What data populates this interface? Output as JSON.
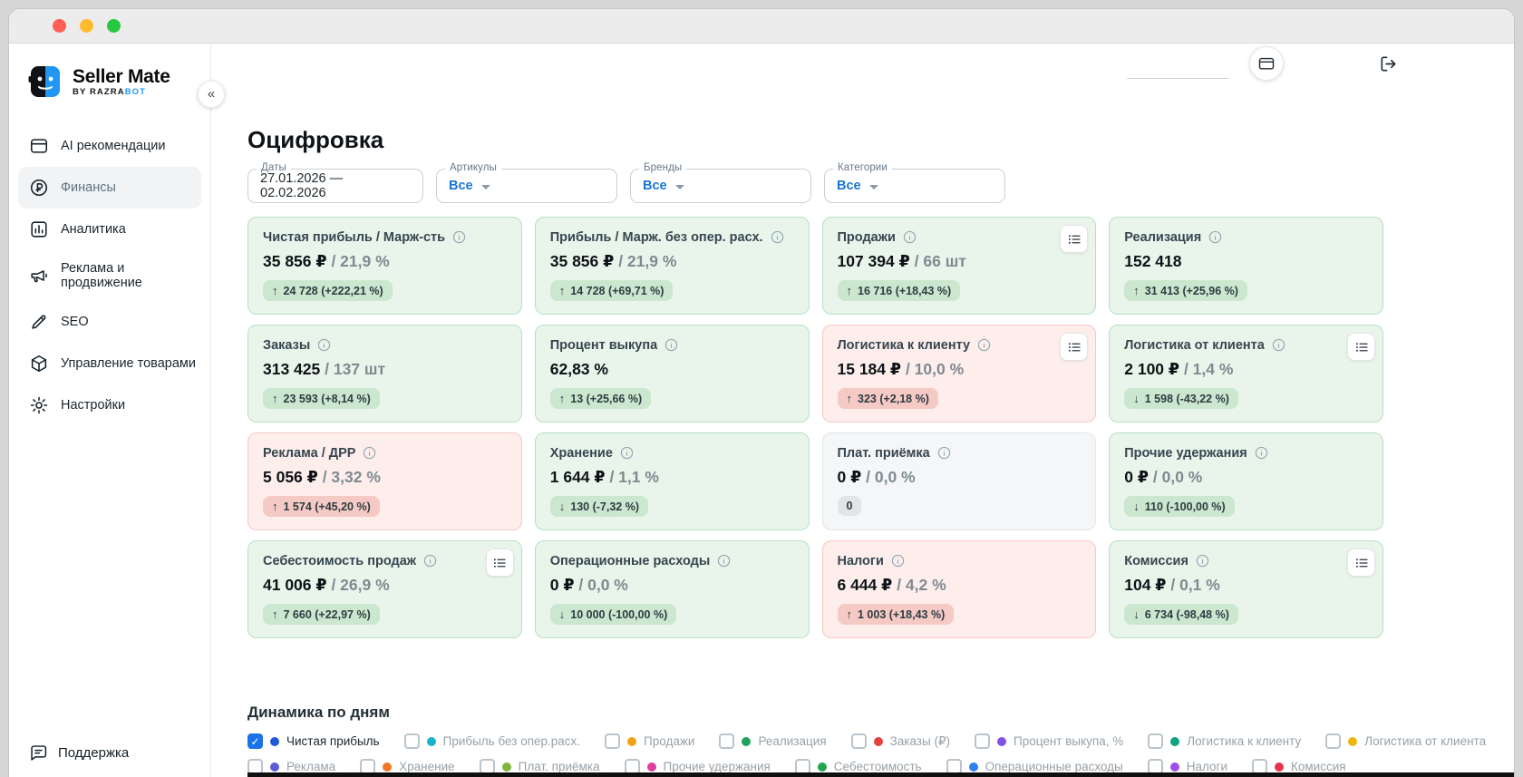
{
  "brand": {
    "name": "Seller Mate",
    "byline_prefix": "BY RAZRA",
    "byline_accent": "BOT"
  },
  "sidebar": {
    "collapse_glyph": "«",
    "items": [
      {
        "label": "AI рекомендации",
        "icon": "ai-card",
        "active": false
      },
      {
        "label": "Финансы",
        "icon": "ruble",
        "active": true
      },
      {
        "label": "Аналитика",
        "icon": "chart",
        "active": false
      },
      {
        "label": "Реклама и продвижение",
        "icon": "megaphone",
        "active": false
      },
      {
        "label": "SEO",
        "icon": "pen",
        "active": false
      },
      {
        "label": "Управление товарами",
        "icon": "box",
        "active": false
      },
      {
        "label": "Настройки",
        "icon": "gear",
        "active": false
      }
    ],
    "support_label": "Поддержка"
  },
  "topbar": {
    "buttons": [
      {
        "name": "card-button",
        "icon": "card"
      },
      {
        "name": "logout-button",
        "icon": "logout"
      }
    ]
  },
  "page": {
    "title": "Оцифровка"
  },
  "filters": {
    "date": {
      "label": "Даты",
      "value": "27.01.2026 — 02.02.2026"
    },
    "selects": [
      {
        "label": "Артикулы",
        "value": "Все"
      },
      {
        "label": "Бренды",
        "value": "Все"
      },
      {
        "label": "Категории",
        "value": "Все"
      }
    ]
  },
  "cards": [
    {
      "title": "Чистая прибыль / Марж-сть",
      "primary": "35 856 ₽",
      "secondary": "21,9 %",
      "tone": "green",
      "badge_arrow": "↑",
      "badge_text": "24 728 (+222,21 %)",
      "list_button": false
    },
    {
      "title": "Прибыль / Марж. без опер. расх.",
      "primary": "35 856 ₽",
      "secondary": "21,9 %",
      "tone": "green",
      "badge_arrow": "↑",
      "badge_text": "14 728 (+69,71 %)",
      "list_button": false
    },
    {
      "title": "Продажи",
      "primary": "107 394 ₽",
      "secondary": "66 шт",
      "tone": "green",
      "badge_arrow": "↑",
      "badge_text": "16 716 (+18,43 %)",
      "list_button": true
    },
    {
      "title": "Реализация",
      "primary": "152 418",
      "secondary": "",
      "tone": "green",
      "badge_arrow": "↑",
      "badge_text": "31 413 (+25,96 %)",
      "list_button": false
    },
    {
      "title": "Заказы",
      "primary": "313 425",
      "secondary": "137 шт",
      "tone": "green",
      "badge_arrow": "↑",
      "badge_text": "23 593 (+8,14 %)",
      "list_button": false
    },
    {
      "title": "Процент выкупа",
      "primary": "62,83 %",
      "secondary": "",
      "tone": "green",
      "badge_arrow": "↑",
      "badge_text": "13 (+25,66 %)",
      "list_button": false
    },
    {
      "title": "Логистика к клиенту",
      "primary": "15 184 ₽",
      "secondary": "10,0 %",
      "tone": "red",
      "badge_arrow": "↑",
      "badge_text": "323 (+2,18 %)",
      "list_button": true
    },
    {
      "title": "Логистика от клиента",
      "primary": "2 100 ₽",
      "secondary": "1,4 %",
      "tone": "green",
      "badge_arrow": "↓",
      "badge_text": "1 598 (-43,22 %)",
      "list_button": true
    },
    {
      "title": "Реклама / ДРР",
      "primary": "5 056 ₽",
      "secondary": "3,32 %",
      "tone": "red",
      "badge_arrow": "↑",
      "badge_text": "1 574 (+45,20 %)",
      "list_button": false
    },
    {
      "title": "Хранение",
      "primary": "1 644 ₽",
      "secondary": "1,1 %",
      "tone": "green",
      "badge_arrow": "↓",
      "badge_text": "130 (-7,32 %)",
      "list_button": false
    },
    {
      "title": "Плат. приёмка",
      "primary": "0 ₽",
      "secondary": "0,0 %",
      "tone": "gray",
      "badge_arrow": "",
      "badge_text": "0",
      "list_button": false
    },
    {
      "title": "Прочие удержания",
      "primary": "0 ₽",
      "secondary": "0,0 %",
      "tone": "green",
      "badge_arrow": "↓",
      "badge_text": "110 (-100,00 %)",
      "list_button": false
    },
    {
      "title": "Себестоимость продаж",
      "primary": "41 006 ₽",
      "secondary": "26,9 %",
      "tone": "green",
      "badge_arrow": "↑",
      "badge_text": "7 660 (+22,97 %)",
      "list_button": true
    },
    {
      "title": "Операционные расходы",
      "primary": "0 ₽",
      "secondary": "0,0 %",
      "tone": "green",
      "badge_arrow": "↓",
      "badge_text": "10 000 (-100,00 %)",
      "list_button": false
    },
    {
      "title": "Налоги",
      "primary": "6 444 ₽",
      "secondary": "4,2 %",
      "tone": "red",
      "badge_arrow": "↑",
      "badge_text": "1 003 (+18,43 %)",
      "list_button": false
    },
    {
      "title": "Комиссия",
      "primary": "104 ₽",
      "secondary": "0,1 %",
      "tone": "green",
      "badge_arrow": "↓",
      "badge_text": "6 734 (-98,48 %)",
      "list_button": true
    }
  ],
  "dynamics": {
    "title": "Динамика по дням",
    "legend_rows": [
      [
        {
          "label": "Чистая прибыль",
          "color": "#2456d8",
          "checked": true
        },
        {
          "label": "Прибыль без опер.расх.",
          "color": "#17b3c9",
          "checked": false
        },
        {
          "label": "Продажи",
          "color": "#f2a218",
          "checked": false
        },
        {
          "label": "Реализация",
          "color": "#1da35a",
          "checked": false
        },
        {
          "label": "Заказы (₽)",
          "color": "#e8413c",
          "checked": false
        },
        {
          "label": "Процент выкупа, %",
          "color": "#8250e8",
          "checked": false
        },
        {
          "label": "Логистика к клиенту",
          "color": "#0ea37f",
          "checked": false
        },
        {
          "label": "Логистика от клиента",
          "color": "#ecb50f",
          "checked": false
        }
      ],
      [
        {
          "label": "Реклама",
          "color": "#5b5bd6",
          "checked": false
        },
        {
          "label": "Хранение",
          "color": "#f07826",
          "checked": false
        },
        {
          "label": "Плат. приёмка",
          "color": "#7fb63c",
          "checked": false
        },
        {
          "label": "Прочие удержания",
          "color": "#df3f9e",
          "checked": false
        },
        {
          "label": "Себестоимость",
          "color": "#21a44a",
          "checked": false
        },
        {
          "label": "Операционные расходы",
          "color": "#2d7ff0",
          "checked": false
        },
        {
          "label": "Налоги",
          "color": "#9b51e8",
          "checked": false
        },
        {
          "label": "Комиссия",
          "color": "#e3344e",
          "checked": false
        }
      ]
    ]
  },
  "colors": {
    "brand_accent": "#2196f3",
    "accent_blue": "#1976d2",
    "checkbox_checked": "#1a73e8",
    "positive_card_bg": "#e9f5eb",
    "negative_card_bg": "#fdeeec",
    "neutral_card_bg": "#f4f6f7",
    "badge_green": "#cbe7cf",
    "badge_red": "#f5c9c4",
    "badge_gray": "#e1e5e7"
  }
}
